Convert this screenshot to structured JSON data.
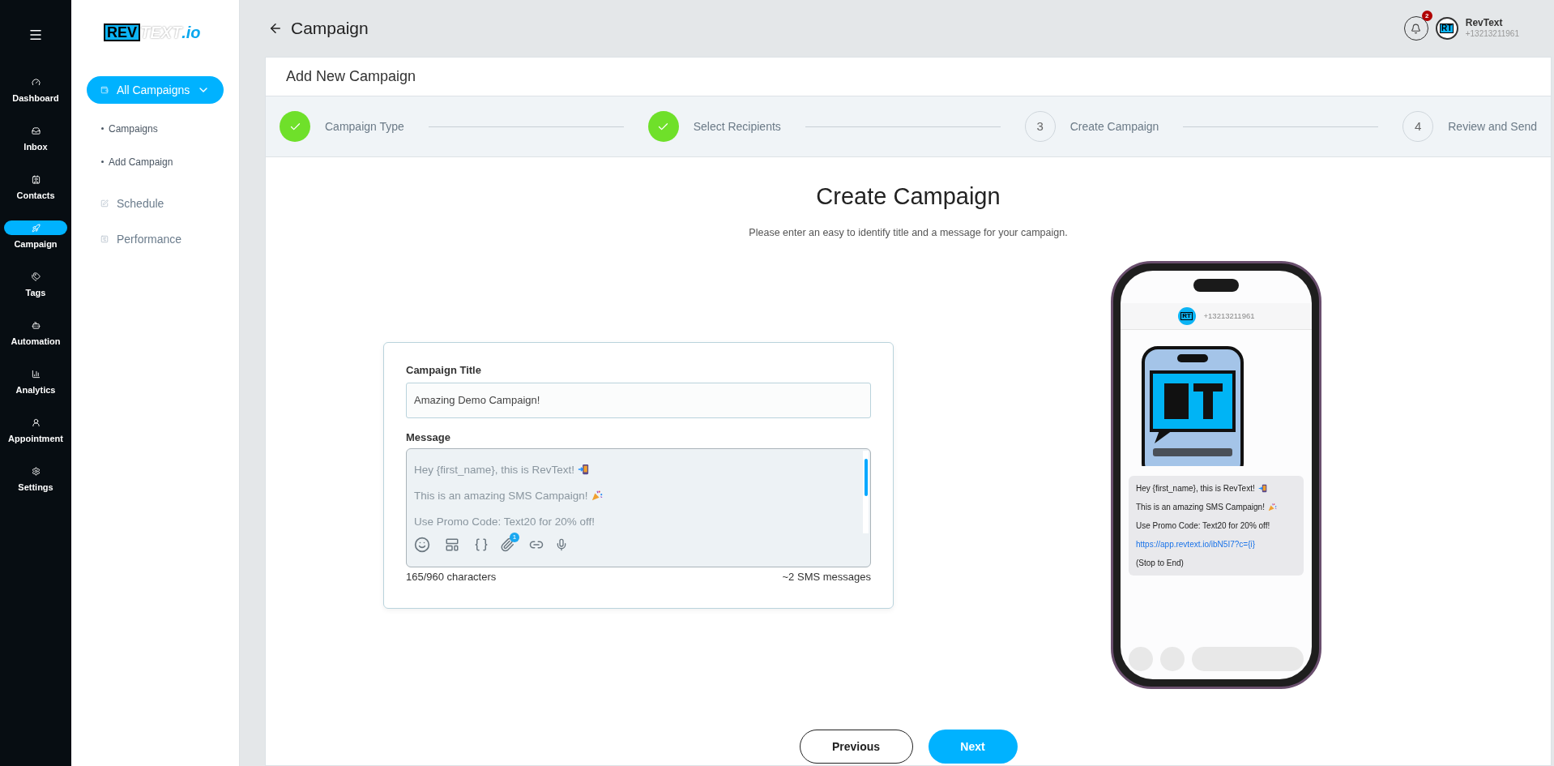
{
  "rail": {
    "items": [
      {
        "label": "Dashboard",
        "selected": false
      },
      {
        "label": "Inbox",
        "selected": false
      },
      {
        "label": "Contacts",
        "selected": false
      },
      {
        "label": "Campaign",
        "selected": true
      },
      {
        "label": "Tags",
        "selected": false
      },
      {
        "label": "Automation",
        "selected": false
      },
      {
        "label": "Analytics",
        "selected": false
      },
      {
        "label": "Appointment",
        "selected": false
      },
      {
        "label": "Settings",
        "selected": false
      }
    ]
  },
  "logo": {
    "left": "REV",
    "right": "TEXT",
    "suffix": ".io"
  },
  "sidebar": {
    "items": [
      {
        "label": "All Campaigns",
        "selected": true,
        "expanded": true,
        "children": [
          {
            "label": "Campaigns"
          },
          {
            "label": "Add Campaign"
          }
        ]
      },
      {
        "label": "Schedule",
        "selected": false
      },
      {
        "label": "Performance",
        "selected": false
      }
    ]
  },
  "header": {
    "title": "Campaign",
    "notifications": "2",
    "avatar": "RT",
    "user_name": "RevText",
    "user_phone": "+13213211961"
  },
  "panel_title": "Add New Campaign",
  "steps": [
    {
      "label": "Campaign Type",
      "completed": true
    },
    {
      "label": "Select Recipients",
      "completed": true
    },
    {
      "number": "3",
      "label": "Create Campaign",
      "completed": false
    },
    {
      "number": "4",
      "label": "Review and Send",
      "completed": false
    }
  ],
  "heading": "Create Campaign",
  "subtitle": "Please enter an easy to identify title and a message for your campaign.",
  "form": {
    "title_label": "Campaign Title",
    "title_value": "Amazing Demo Campaign!",
    "message_label": "Message",
    "message_lines": [
      {
        "kind": "phone",
        "text": "Hey {first_name}, this is RevText!"
      },
      {
        "kind": "party",
        "text": "This is an amazing SMS Campaign!"
      },
      {
        "kind": "plain",
        "text": "Use Promo Code: Text20 for 20% off!"
      }
    ],
    "attachments": "1",
    "char_count": "165/960 characters",
    "sms_count": "~2 SMS messages"
  },
  "preview": {
    "avatar": "RT",
    "phone": "+13213211961",
    "lines": [
      {
        "kind": "phone",
        "text": "Hey {first_name}, this is RevText!"
      },
      {
        "kind": "party",
        "text": "This is an amazing SMS Campaign!"
      },
      {
        "kind": "text",
        "text": "Use Promo Code: Text20 for 20% off!"
      },
      {
        "kind": "link",
        "text": "https://app.revtext.io/ibN5I7?c={i}"
      },
      {
        "kind": "text",
        "text": "(Stop to End)"
      }
    ]
  },
  "buttons": {
    "previous": "Previous",
    "next": "Next"
  }
}
